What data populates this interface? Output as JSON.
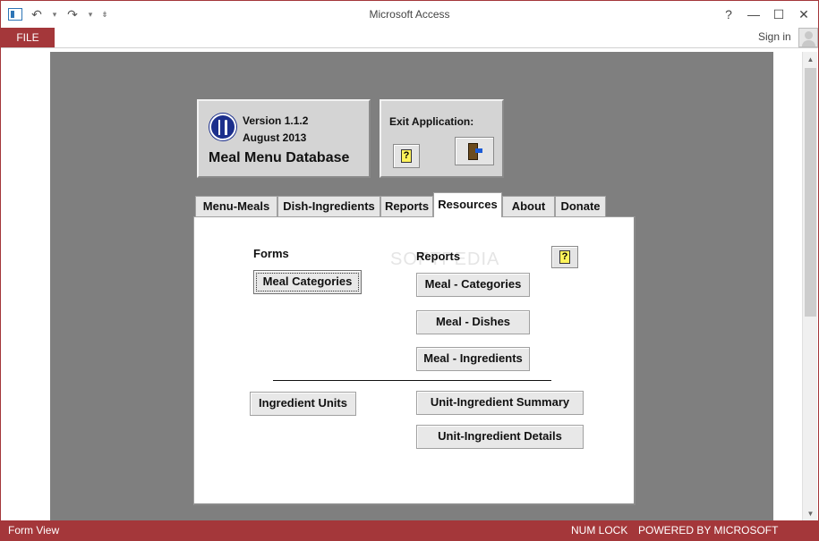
{
  "window": {
    "title": "Microsoft Access"
  },
  "ribbon": {
    "file_tab": "FILE",
    "sign_in": "Sign in"
  },
  "header": {
    "version": "Version 1.1.2",
    "date": "August 2013",
    "db_title": "Meal Menu Database",
    "exit_label": "Exit Application:",
    "help_glyph": "?"
  },
  "tabs": [
    {
      "label": "Menu-Meals",
      "active": false
    },
    {
      "label": "Dish-Ingredients",
      "active": false
    },
    {
      "label": "Reports",
      "active": false
    },
    {
      "label": "Resources",
      "active": true
    },
    {
      "label": "About",
      "active": false
    },
    {
      "label": "Donate",
      "active": false
    }
  ],
  "resources": {
    "forms_label": "Forms",
    "reports_label": "Reports",
    "help_glyph": "?",
    "watermark": "SOFTPEDIA",
    "form_buttons": [
      "Meal Categories",
      "Ingredient Units"
    ],
    "report_buttons": [
      "Meal - Categories",
      "Meal - Dishes",
      "Meal - Ingredients",
      "Unit-Ingredient Summary",
      "Unit-Ingredient Details"
    ]
  },
  "statusbar": {
    "view": "Form View",
    "num_lock": "NUM LOCK",
    "powered": "POWERED BY MICROSOFT ACCESS"
  },
  "colors": {
    "accent": "#a4373a",
    "form_background": "#7f7f7f",
    "panel": "#d4d4d4"
  }
}
